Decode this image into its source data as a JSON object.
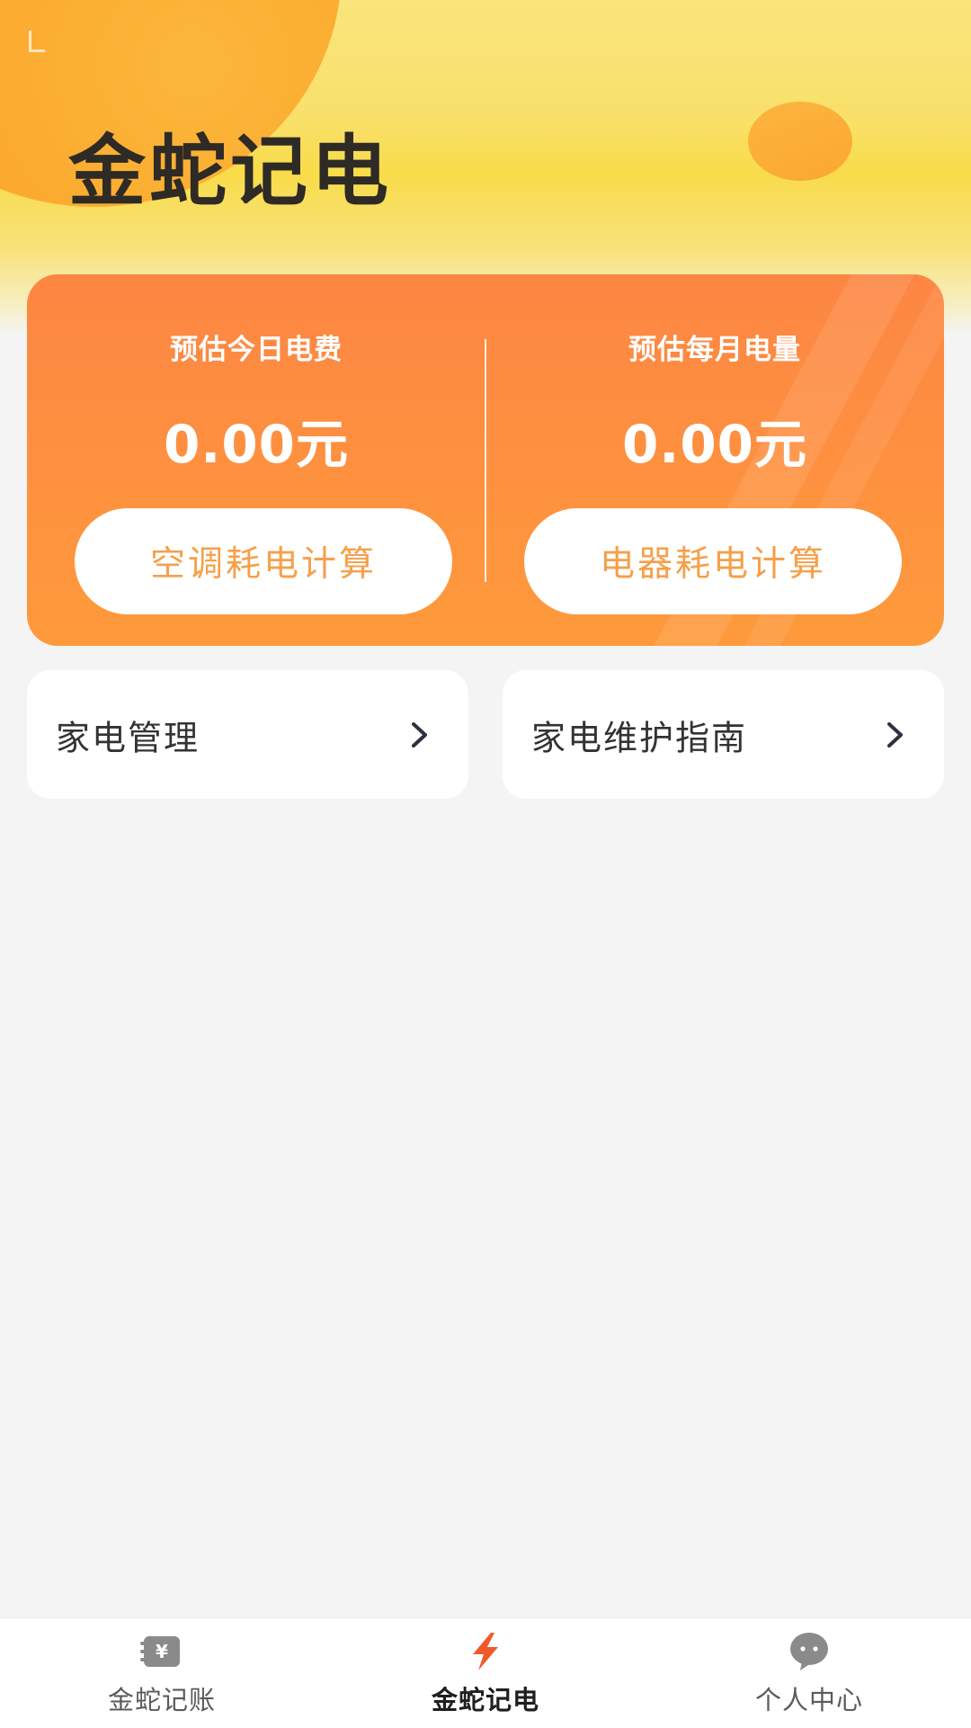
{
  "header": {
    "title": "金蛇记电"
  },
  "estimates": {
    "today": {
      "label": "预估今日电费",
      "value": "0.00元",
      "button_label": "空调耗电计算"
    },
    "month": {
      "label": "预估每月电量",
      "value": "0.00元",
      "button_label": "电器耗电计算"
    }
  },
  "links": {
    "appliance_management": "家电管理",
    "maintenance_guide": "家电维护指南"
  },
  "nav": {
    "items": [
      {
        "label": "金蛇记账",
        "icon": "ledger-icon"
      },
      {
        "label": "金蛇记电",
        "icon": "lightning-icon",
        "active": true
      },
      {
        "label": "个人中心",
        "icon": "chat-bubble-icon"
      }
    ]
  },
  "colors": {
    "card_orange": "#fd8643",
    "button_text": "#f6a04a",
    "label_highlight": "#fbd61c",
    "active_icon": "#f05a2b",
    "inactive_icon": "#8a8a8a"
  }
}
